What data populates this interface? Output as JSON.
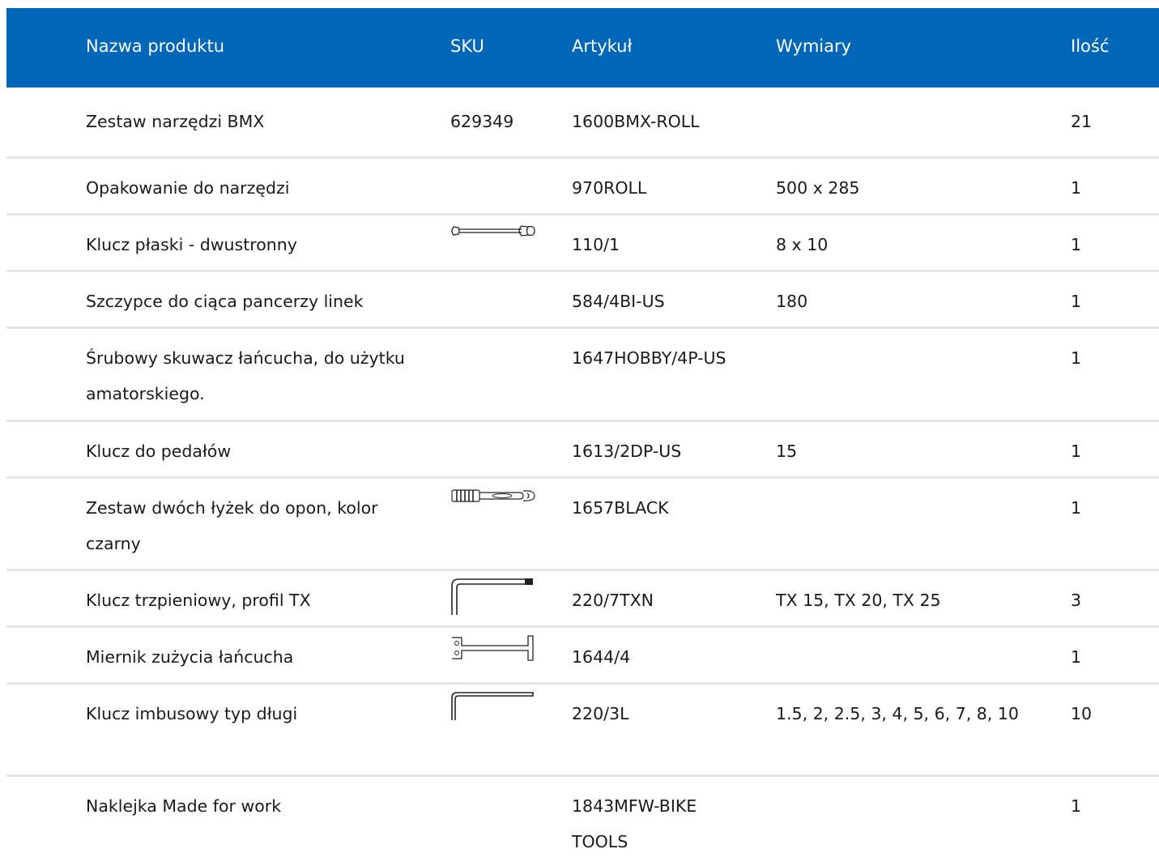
{
  "header": {
    "name": "Nazwa produktu",
    "sku": "SKU",
    "article": "Artykuł",
    "dimensions": "Wymiary",
    "qty": "Ilość"
  },
  "accent_color": "#0066b8",
  "rows": [
    {
      "name": "Zestaw narzędzi BMX",
      "sku": "629349",
      "article": "1600BMX-ROLL",
      "dimensions": "",
      "qty": "21",
      "icon": ""
    },
    {
      "name": "Opakowanie do narzędzi",
      "sku": "",
      "article": "970ROLL",
      "dimensions": "500 x 285",
      "qty": "1",
      "icon": ""
    },
    {
      "name": "Klucz płaski - dwustronny",
      "sku": "",
      "article": "110/1",
      "dimensions": "8 x 10",
      "qty": "1",
      "icon": "open-end-wrench-icon"
    },
    {
      "name": "Szczypce do ciąca pancerzy linek",
      "sku": "",
      "article": "584/4BI-US",
      "dimensions": "180",
      "qty": "1",
      "icon": ""
    },
    {
      "name": "Śrubowy skuwacz łańcucha, do użytku amatorskiego.",
      "sku": "",
      "article": "1647HOBBY/4P-US",
      "dimensions": "",
      "qty": "1",
      "icon": ""
    },
    {
      "name": "Klucz do pedałów",
      "sku": "",
      "article": "1613/2DP-US",
      "dimensions": "15",
      "qty": "1",
      "icon": ""
    },
    {
      "name": "Zestaw dwóch łyżek do opon, kolor czarny",
      "sku": "",
      "article": "1657BLACK",
      "dimensions": "",
      "qty": "1",
      "icon": "tire-lever-icon"
    },
    {
      "name": "Klucz trzpieniowy, profil TX",
      "sku": "",
      "article": "220/7TXN",
      "dimensions": "TX 15, TX 20, TX 25",
      "qty": "3",
      "icon": "torx-key-icon"
    },
    {
      "name": "Miernik zużycia łańcucha",
      "sku": "",
      "article": "1644/4",
      "dimensions": "",
      "qty": "1",
      "icon": "chain-gauge-icon"
    },
    {
      "name": "Klucz imbusowy typ długi",
      "sku": "",
      "article": "220/3L",
      "dimensions": "1.5, 2, 2.5, 3, 4, 5, 6, 7, 8, 10",
      "qty": "10",
      "icon": "hex-key-icon"
    },
    {
      "name": "Naklejka Made for work",
      "sku": "",
      "article": "1843MFW-BIKE TOOLS",
      "dimensions": "",
      "qty": "1",
      "icon": ""
    }
  ]
}
